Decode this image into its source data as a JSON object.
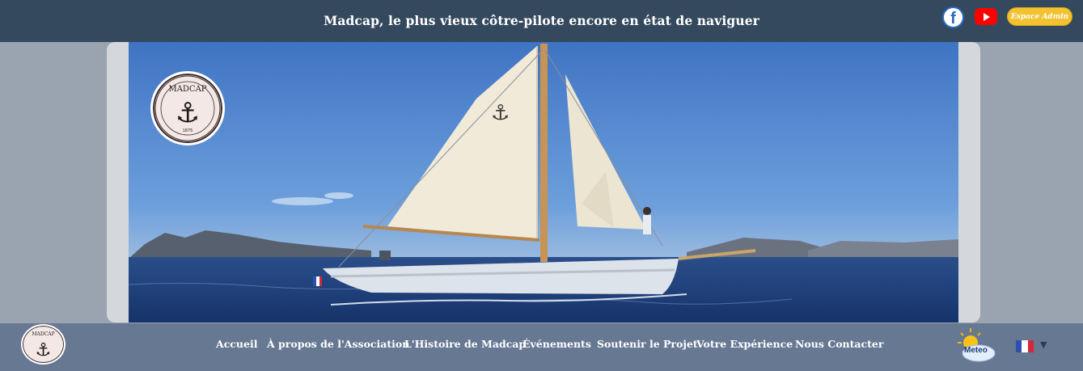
{
  "header": {
    "title": "Madcap, le plus vieux côtre-pilote encore en état de naviguer",
    "facebook_icon": "facebook-icon",
    "facebook_letter": "f",
    "youtube_icon": "youtube-icon",
    "admin_button": "Espace Admin"
  },
  "hero": {
    "logo_text": "MADCAP",
    "logo_year": "1875"
  },
  "nav": {
    "items": [
      "Accueil",
      "À propos de l'Association",
      "L'Histoire de Madcap",
      "Événements",
      "Soutenir le Projet",
      "Votre Expérience",
      "Nous Contacter"
    ],
    "meteo_label": "Meteo",
    "language": "fr",
    "language_caret": "▼"
  },
  "colors": {
    "topbar": "#34495e",
    "navbar": "#677893",
    "admin": "#f2c230",
    "sea": "#1f3f78",
    "sky": "#4f86cf"
  }
}
